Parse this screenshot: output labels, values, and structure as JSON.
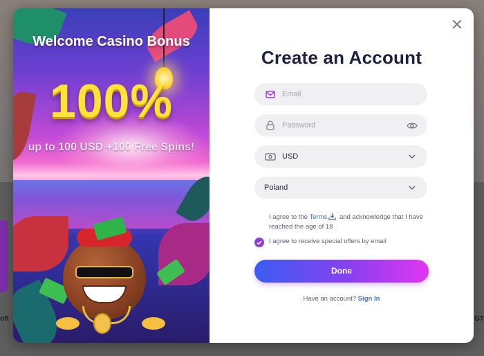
{
  "background": {
    "left_text": "oft",
    "right_text": "GT"
  },
  "promo": {
    "title": "Welcome Casino Bonus",
    "amount": "100%",
    "subtitle": "up to 100 USD +100 Free Spins!"
  },
  "form": {
    "title": "Create an Account",
    "email": {
      "placeholder": "Email",
      "value": ""
    },
    "password": {
      "placeholder": "Password",
      "value": ""
    },
    "currency": {
      "value": "USD"
    },
    "country": {
      "value": "Poland"
    },
    "terms": {
      "prefix": "I agree to the",
      "link": "Terms",
      "suffix": "and acknowledge that I have reached the age of 18",
      "checked": false
    },
    "offers": {
      "label": "I agree to receive special offers by email",
      "checked": true
    },
    "submit_label": "Done",
    "signin_prompt": "Have an account?",
    "signin_link": "Sign In"
  },
  "colors": {
    "accent_start": "#3a5df0",
    "accent_end": "#e036f0",
    "title": "#1f2142",
    "link": "#3f6fd8",
    "checkbox": "#8b3fd6"
  },
  "icons": {
    "close": "close-icon",
    "email": "envelope-icon",
    "password": "lock-icon",
    "show_password": "eye-icon",
    "currency": "banknote-icon",
    "dropdown": "chevron-down-icon",
    "terms_download": "download-icon",
    "check": "check-icon"
  }
}
